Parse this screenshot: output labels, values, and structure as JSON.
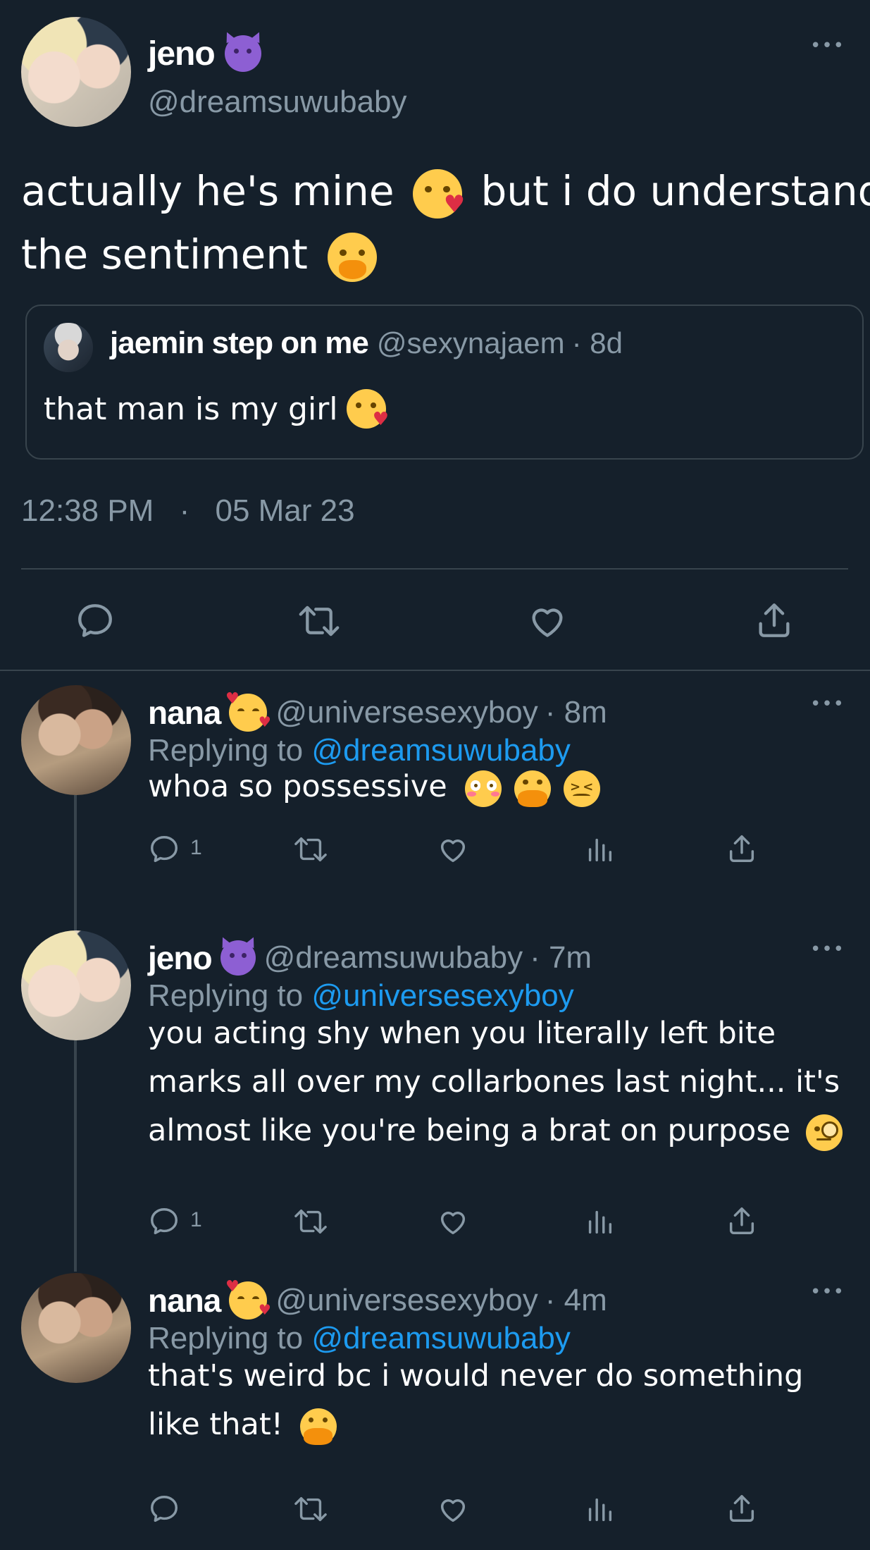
{
  "main_tweet": {
    "display_name": "jeno",
    "name_emoji": "smiling-imp-icon",
    "handle": "@dreamsuwubaby",
    "text_part1": "actually he's mine",
    "text_part1_emoji": "face-blowing-kiss-icon",
    "text_part2": "but i do understand",
    "text_part3": "the sentiment",
    "text_part3_emoji": "face-with-hand-over-mouth-icon",
    "timestamp_time": "12:38 PM",
    "timestamp_sep": "·",
    "timestamp_date": "05 Mar 23",
    "quote": {
      "display_name": "jaemin step on me",
      "handle": "@sexynajaem",
      "meta": "· 8d",
      "text": "that man is my girl",
      "text_emoji": "face-blowing-kiss-icon"
    }
  },
  "replies": [
    {
      "display_name": "nana",
      "name_emoji": "smiling-face-with-hearts-icon",
      "handle": "@universesexyboy",
      "meta": "· 8m",
      "replying_prefix": "Replying to",
      "replying_to": "@dreamsuwubaby",
      "lines": [
        "whoa so possessive"
      ],
      "text_emojis": [
        "flushed-face-icon",
        "face-with-open-eyes-and-hand-over-mouth-icon",
        "confounded-face-icon"
      ],
      "reply_count": "1"
    },
    {
      "display_name": "jeno",
      "name_emoji": "smiling-imp-icon",
      "handle": "@dreamsuwubaby",
      "meta": "· 7m",
      "replying_prefix": "Replying to",
      "replying_to": "@universesexyboy",
      "lines": [
        "you acting shy when you literally left bite",
        "marks all over my collarbones last night... it's",
        "almost like you're being a brat on purpose"
      ],
      "text_emojis": [
        "face-with-monocle-icon"
      ],
      "reply_count": "1"
    },
    {
      "display_name": "nana",
      "name_emoji": "smiling-face-with-hearts-icon",
      "handle": "@universesexyboy",
      "meta": "· 4m",
      "replying_prefix": "Replying to",
      "replying_to": "@dreamsuwubaby",
      "lines": [
        "that's weird bc i would never do something",
        "like that!"
      ],
      "text_emojis": [
        "face-with-open-eyes-and-hand-over-mouth-icon"
      ],
      "reply_count": ""
    }
  ],
  "colors": {
    "background": "#15202b",
    "text": "#ffffff",
    "muted": "#8899a6",
    "link": "#1d9bf0",
    "border": "#38444d"
  }
}
